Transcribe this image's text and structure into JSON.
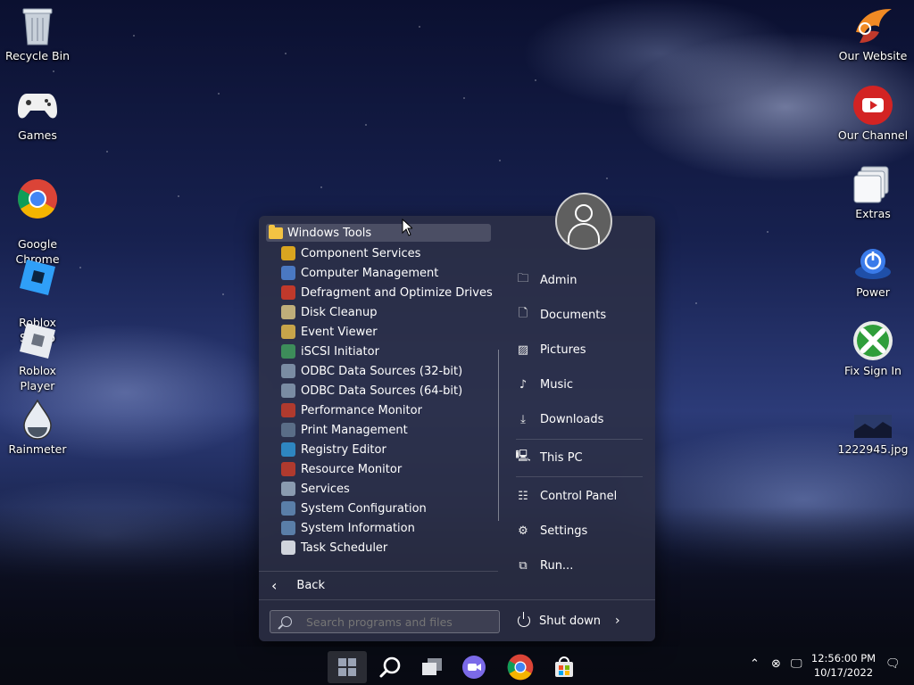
{
  "desktop": {
    "left_icons": [
      {
        "label": "Recycle Bin",
        "icon": "recycle-bin-icon"
      },
      {
        "label": "Games",
        "icon": "game-controller-icon"
      },
      {
        "label": "Google\nChrome",
        "icon": "chrome-icon"
      },
      {
        "label": "Roblox\nStudio",
        "icon": "roblox-studio-icon"
      },
      {
        "label": "Roblox Player",
        "icon": "roblox-player-icon"
      },
      {
        "label": "Rainmeter",
        "icon": "rainmeter-icon"
      }
    ],
    "right_icons": [
      {
        "label": "Our Website",
        "icon": "bird-logo-icon"
      },
      {
        "label": "Our Channel",
        "icon": "youtube-icon"
      },
      {
        "label": "Extras",
        "icon": "folder-stack-icon"
      },
      {
        "label": "Power",
        "icon": "power-orb-icon"
      },
      {
        "label": "Fix Sign In",
        "icon": "xbox-icon"
      },
      {
        "label": "1222945.jpg",
        "icon": "image-file-icon"
      }
    ]
  },
  "start_menu": {
    "folder": "Windows Tools",
    "programs": [
      {
        "label": "Component Services",
        "icon": "component-services-icon",
        "color": "#d9a520"
      },
      {
        "label": "Computer Management",
        "icon": "computer-management-icon",
        "color": "#4a78c2"
      },
      {
        "label": "Defragment and Optimize Drives",
        "icon": "defrag-icon",
        "color": "#c0392b"
      },
      {
        "label": "Disk Cleanup",
        "icon": "disk-cleanup-icon",
        "color": "#bfae7a"
      },
      {
        "label": "Event Viewer",
        "icon": "event-viewer-icon",
        "color": "#c7a44a"
      },
      {
        "label": "iSCSI Initiator",
        "icon": "iscsi-icon",
        "color": "#3d8d5a"
      },
      {
        "label": "ODBC Data Sources (32-bit)",
        "icon": "odbc-icon",
        "color": "#7a8ca3"
      },
      {
        "label": "ODBC Data Sources (64-bit)",
        "icon": "odbc-icon",
        "color": "#7a8ca3"
      },
      {
        "label": "Performance Monitor",
        "icon": "performance-monitor-icon",
        "color": "#b03a2e"
      },
      {
        "label": "Print Management",
        "icon": "printer-icon",
        "color": "#5a6d87"
      },
      {
        "label": "Registry Editor",
        "icon": "registry-editor-icon",
        "color": "#2e86c1"
      },
      {
        "label": "Resource Monitor",
        "icon": "resource-monitor-icon",
        "color": "#b03a2e"
      },
      {
        "label": "Services",
        "icon": "gear-icon",
        "color": "#8a9bb0"
      },
      {
        "label": "System Configuration",
        "icon": "system-configuration-icon",
        "color": "#5a7ea8"
      },
      {
        "label": "System Information",
        "icon": "system-information-icon",
        "color": "#5a7ea8"
      },
      {
        "label": "Task Scheduler",
        "icon": "task-scheduler-icon",
        "color": "#d0d4dc"
      }
    ],
    "back_label": "Back",
    "search_placeholder": "Search programs and files",
    "right_items": [
      {
        "label": "Admin",
        "icon": "user-folder-icon"
      },
      {
        "label": "Documents",
        "icon": "document-icon"
      },
      {
        "label": "Pictures",
        "icon": "picture-icon"
      },
      {
        "label": "Music",
        "icon": "music-note-icon"
      },
      {
        "label": "Downloads",
        "icon": "download-arrow-icon"
      },
      {
        "label": "This PC",
        "icon": "computer-icon"
      },
      {
        "label": "Control Panel",
        "icon": "control-panel-icon"
      },
      {
        "label": "Settings",
        "icon": "gear-icon"
      },
      {
        "label": "Run...",
        "icon": "run-icon"
      }
    ],
    "shutdown_label": "Shut down"
  },
  "taskbar": {
    "apps": [
      "start-icon",
      "search-icon",
      "task-view-icon",
      "video-call-icon",
      "chrome-icon",
      "store-icon"
    ],
    "clock_time": "12:56:00 PM",
    "clock_date": "10/17/2022"
  }
}
